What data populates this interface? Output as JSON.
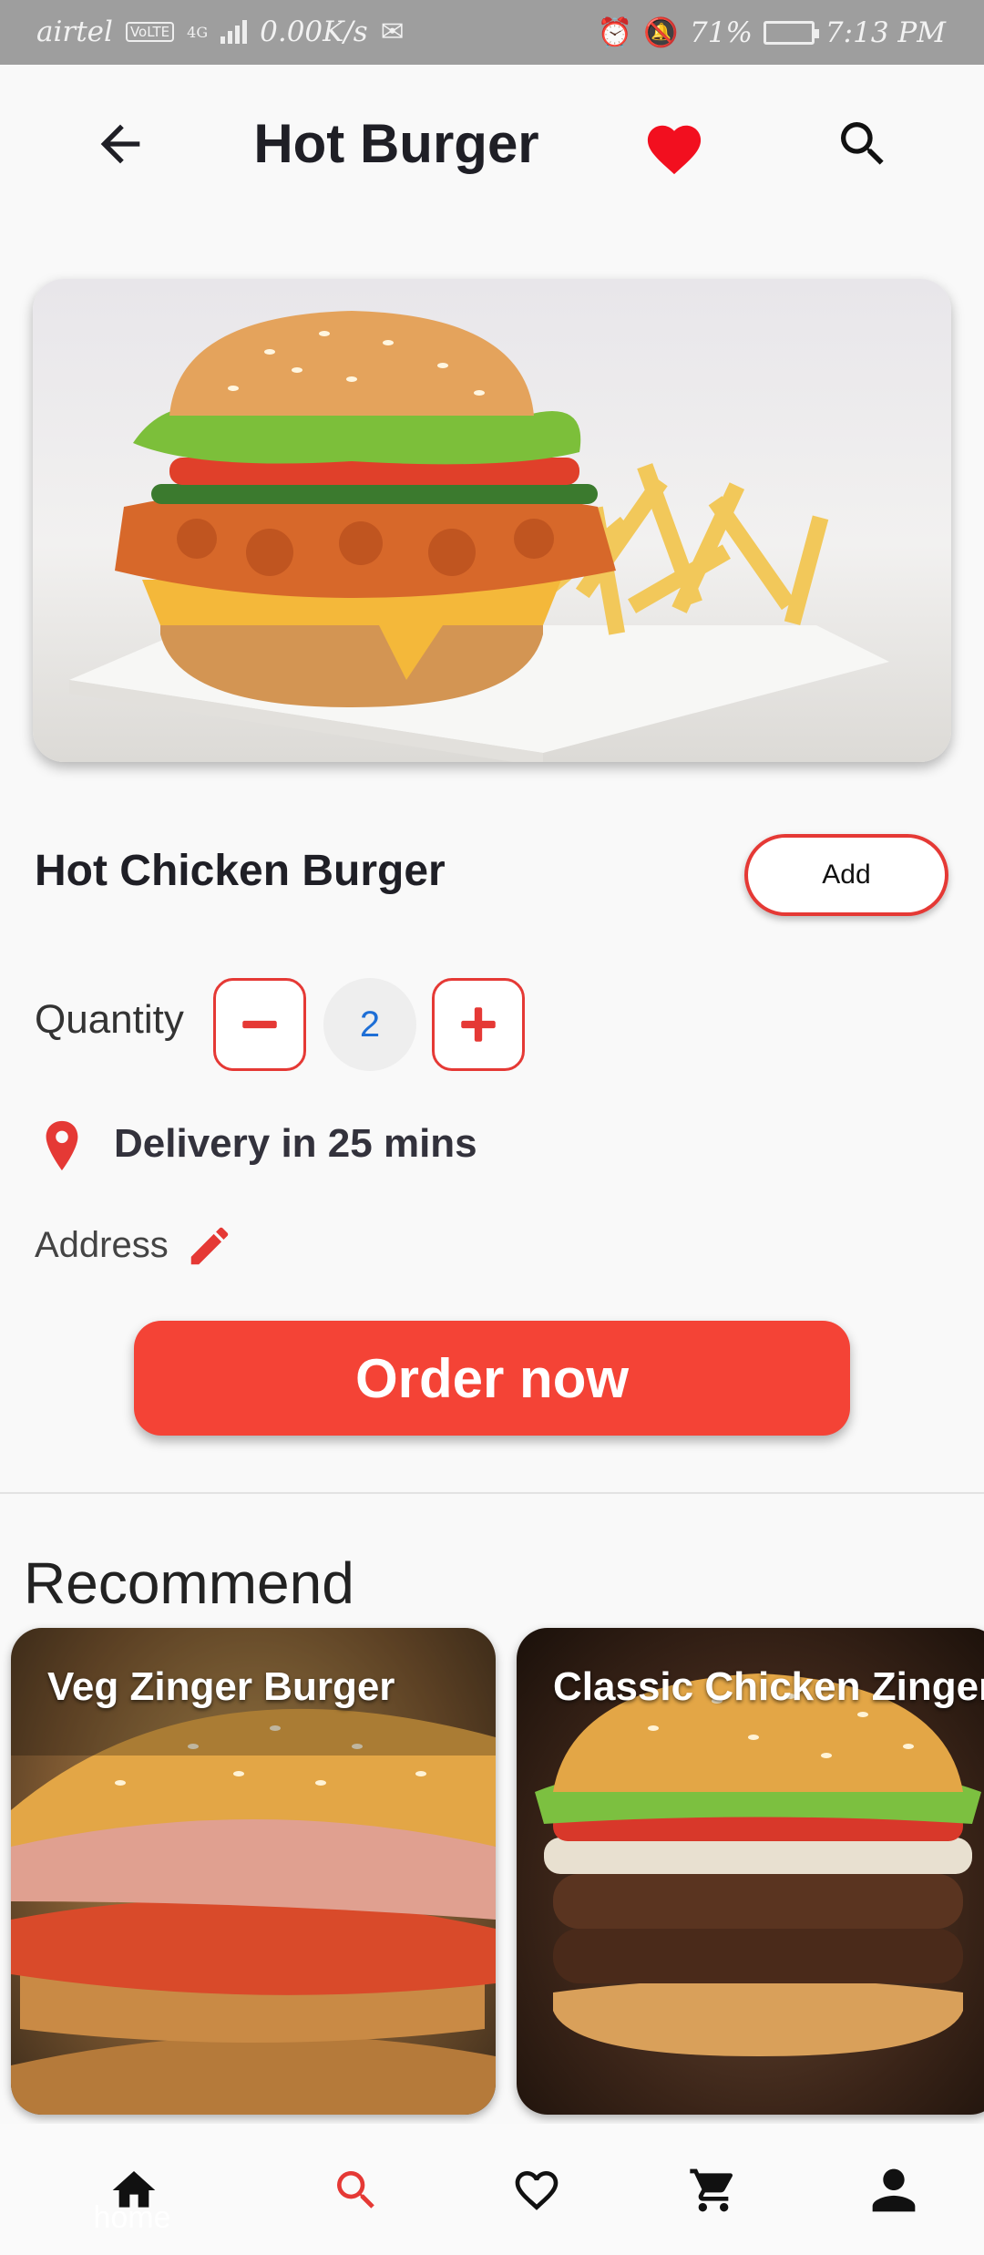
{
  "status_bar": {
    "carrier": "airtel",
    "volte": "VoLTE",
    "network": "4G",
    "speed": "0.00K/s",
    "battery": "71%",
    "time": "7:13 PM"
  },
  "header": {
    "title": "Hot Burger",
    "back_icon": "arrow-left-icon",
    "favorite_icon": "heart-icon",
    "search_icon": "search-icon"
  },
  "product": {
    "name": "Hot Chicken Burger",
    "add_label": "Add",
    "quantity_label": "Quantity",
    "quantity": "2",
    "delivery": "Delivery in 25 mins",
    "address_label": "Address",
    "order_label": "Order now"
  },
  "recommend": {
    "title": "Recommend",
    "items": [
      {
        "label": "Veg Zinger Burger"
      },
      {
        "label": "Classic Chicken Zinger"
      }
    ]
  },
  "bottom_nav": {
    "home_label": "home",
    "items": [
      "home-icon",
      "search-icon",
      "heart-outline-icon",
      "cart-icon",
      "person-icon"
    ]
  },
  "colors": {
    "accent": "#f44336",
    "accent_border": "#e53935",
    "quantity_text": "#1e6fd6"
  }
}
